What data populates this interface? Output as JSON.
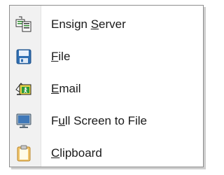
{
  "menu": {
    "items": [
      {
        "pre": "Ensign ",
        "key": "S",
        "post": "erver",
        "icon": "server-send-icon"
      },
      {
        "pre": "",
        "key": "F",
        "post": "ile",
        "icon": "floppy-disk-icon"
      },
      {
        "pre": "",
        "key": "E",
        "post": "mail",
        "icon": "email-icon"
      },
      {
        "pre": "F",
        "key": "u",
        "post": "ll Screen to File",
        "icon": "monitor-icon"
      },
      {
        "pre": "",
        "key": "C",
        "post": "lipboard",
        "icon": "clipboard-icon"
      }
    ]
  },
  "colors": {
    "gutter": "#f1f1f1",
    "border": "#8e8e8e",
    "text": "#1a1a1a"
  }
}
